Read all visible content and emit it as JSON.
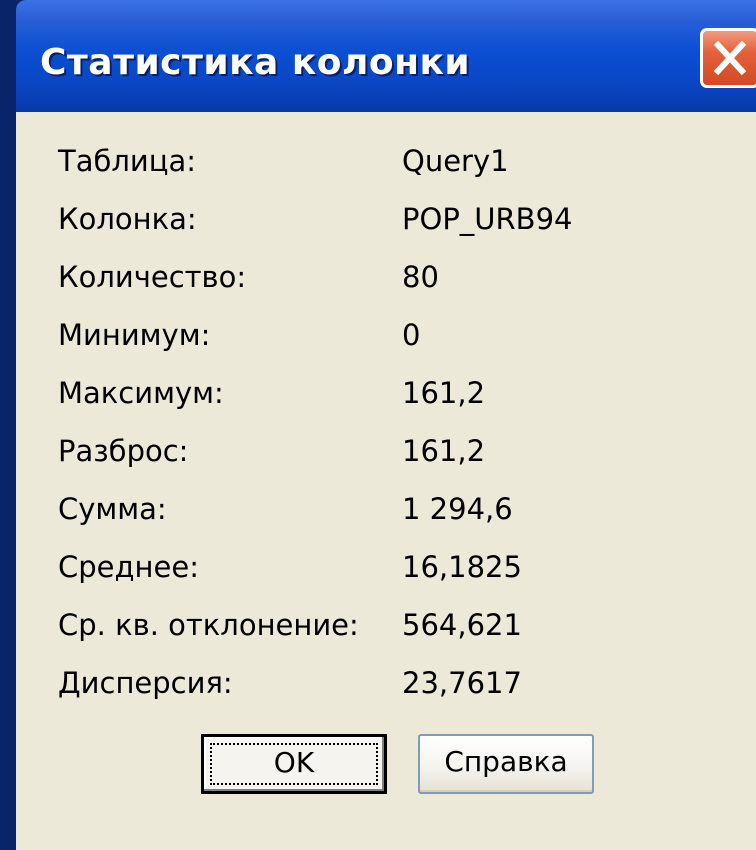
{
  "window": {
    "title": "Статистика колонки",
    "close_icon": "close-icon"
  },
  "colors": {
    "title_bar": "#0b4fd3",
    "close_button": "#e4603c",
    "dialog_background": "#ece9d8"
  },
  "stats": [
    {
      "label": "Таблица:",
      "value": "Query1"
    },
    {
      "label": "Колонка:",
      "value": "POP_URB94"
    },
    {
      "label": "Количество:",
      "value": "80"
    },
    {
      "label": "Минимум:",
      "value": "0"
    },
    {
      "label": "Максимум:",
      "value": "161,2"
    },
    {
      "label": "Разброс:",
      "value": "161,2"
    },
    {
      "label": "Сумма:",
      "value": "1 294,6"
    },
    {
      "label": "Среднее:",
      "value": "16,1825"
    },
    {
      "label": "Ср. кв. отклонение:",
      "value": "564,621"
    },
    {
      "label": "Дисперсия:",
      "value": "23,7617"
    }
  ],
  "buttons": {
    "ok_label": "OK",
    "help_label": "Справка"
  }
}
